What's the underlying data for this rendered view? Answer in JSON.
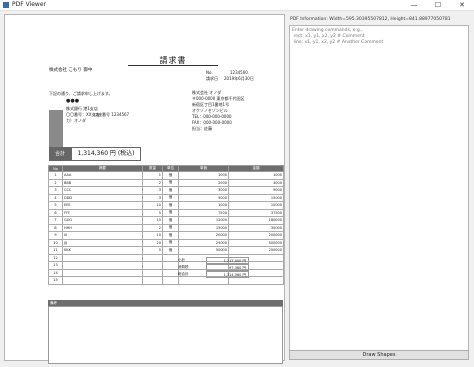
{
  "window": {
    "title": "PDF Viewer",
    "min": "—",
    "max": "☐",
    "close": "✕"
  },
  "invoice": {
    "title": "請求書",
    "recipient": "株式会社 こもり 御中",
    "no_label": "No.",
    "no_value": "1234500",
    "date_label": "請求日",
    "date_value": "2019年6月30日",
    "greeting": "下記の通り、ご請求申し上げます。",
    "pay_name": "●●●",
    "pay_bank": "株式銀行 港1支店",
    "pay_branch": "〇〇番号：XX支店",
    "pay_acct": "口座番号 1234567",
    "pay_holder": "カ）オノダ",
    "issuer": [
      "株式会社 オノダ",
      "〒000-0000 東京都千代田区",
      "新宿区丁目1番地1号",
      "オクゾノセゾンビル",
      "TEL：000-000-0000",
      "FAX：000-000-0000",
      "担当：佐藤"
    ],
    "total_label": "合計",
    "total_value": "1,314,360 円 (税込)",
    "headers": [
      "No",
      "摘要",
      "数量",
      "単位",
      "単価",
      "金額"
    ],
    "rows": [
      [
        "1",
        "AAA",
        "1",
        "個",
        "1000",
        "1000"
      ],
      [
        "2",
        "BBB",
        "2",
        "個",
        "2000",
        "4000"
      ],
      [
        "3",
        "CCC",
        "3",
        "個",
        "3000",
        "9000"
      ],
      [
        "4",
        "DDD",
        "3",
        "個",
        "5000",
        "15000"
      ],
      [
        "5",
        "EEE",
        "10",
        "個",
        "1000",
        "10000"
      ],
      [
        "6",
        "FFF",
        "5",
        "個",
        "7500",
        "37500"
      ],
      [
        "7",
        "GGG",
        "15",
        "個",
        "12000",
        "180000"
      ],
      [
        "8",
        "HHH",
        "2",
        "個",
        "15000",
        "30000"
      ],
      [
        "9",
        "III",
        "10",
        "個",
        "20000",
        "200000"
      ],
      [
        "10",
        "JJJ",
        "20",
        "個",
        "25000",
        "500000"
      ],
      [
        "11",
        "KKK",
        "5",
        "個",
        "50000",
        "250000"
      ],
      [
        "12",
        "",
        "",
        "",
        "",
        ""
      ],
      [
        "13",
        "",
        "",
        "",
        "",
        ""
      ],
      [
        "14",
        "",
        "",
        "",
        "",
        ""
      ],
      [
        "15",
        "",
        "",
        "",
        "",
        ""
      ]
    ],
    "subtotal_label": "小計",
    "subtotal_value": "1,217,000 円",
    "tax_label": "消費税",
    "tax_value": "97,360 円",
    "grand_label": "総合計",
    "grand_value": "1,314,360 円",
    "remarks_label": "備考"
  },
  "panel": {
    "info": "PDF Information: Width=595.30395507812, Height=841.88977050781",
    "placeholder": "Enter drawing commands, e.g.,\n rect: x1, y1, x2, y2 # Comment\n line: x1, y1, x2, y2 # Another Comment",
    "draw_button": "Draw Shapes"
  }
}
